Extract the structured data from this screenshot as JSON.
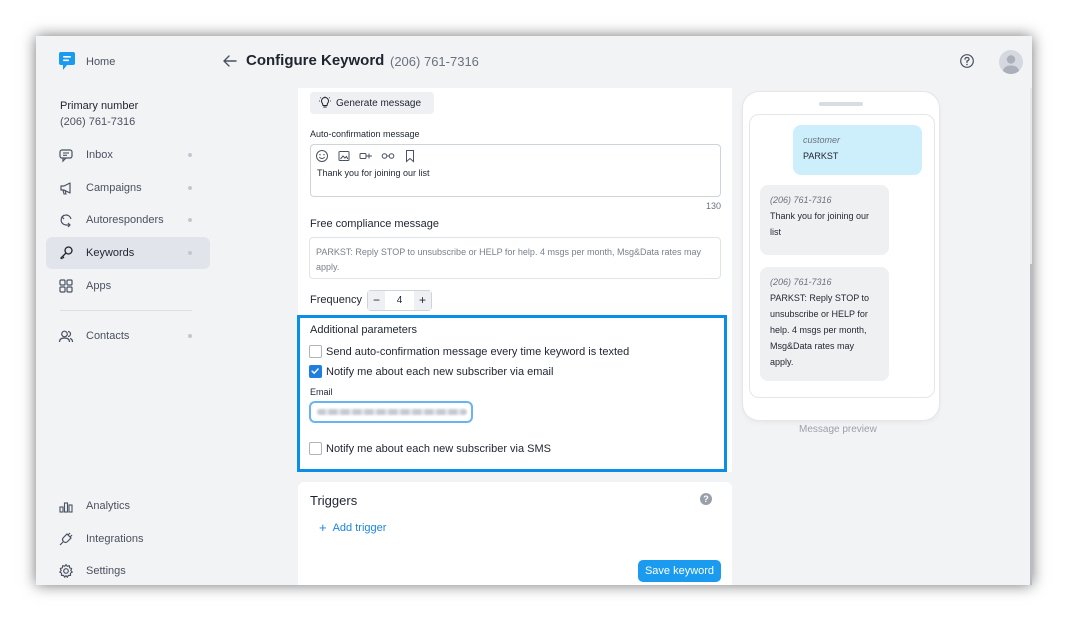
{
  "sidebar": {
    "home_label": "Home",
    "primary_label": "Primary number",
    "primary_number": "(206) 761-7316",
    "items": [
      {
        "label": "Inbox",
        "icon": "inbox-icon"
      },
      {
        "label": "Campaigns",
        "icon": "megaphone-icon"
      },
      {
        "label": "Autoresponders",
        "icon": "autoresponder-icon"
      },
      {
        "label": "Keywords",
        "icon": "key-icon"
      },
      {
        "label": "Apps",
        "icon": "apps-grid-icon"
      },
      {
        "label": "Contacts",
        "icon": "contacts-icon"
      },
      {
        "label": "Analytics",
        "icon": "bar-chart-icon"
      },
      {
        "label": "Integrations",
        "icon": "plug-icon"
      },
      {
        "label": "Settings",
        "icon": "gear-icon"
      }
    ]
  },
  "header": {
    "title": "Configure Keyword",
    "subtitle": "(206) 761-7316"
  },
  "form": {
    "generate_label": "Generate message",
    "auto_confirm_label": "Auto-confirmation message",
    "auto_confirm_value": "Thank you for joining our list",
    "char_count": "130",
    "compliance_label": "Free compliance message",
    "compliance_text": "PARKST: Reply STOP to unsubscribe or HELP for help. 4 msgs per month, Msg&Data rates may apply.",
    "frequency_label": "Frequency",
    "frequency_value": "4",
    "minus": "−",
    "plus": "+"
  },
  "params": {
    "title": "Additional parameters",
    "opt_send_every_time": "Send auto-confirmation message every time keyword is texted",
    "opt_send_every_time_checked": false,
    "opt_notify_email": "Notify me about each new subscriber via email",
    "opt_notify_email_checked": true,
    "email_label": "Email",
    "opt_notify_sms": "Notify me about each new subscriber via SMS",
    "opt_notify_sms_checked": false
  },
  "triggers": {
    "title": "Triggers",
    "help": "?",
    "add_label": "Add trigger",
    "save_label": "Save keyword"
  },
  "preview": {
    "customer_from": "customer",
    "customer_text": "PARKST",
    "reply1_from": "(206) 761-7316",
    "reply1_text": "Thank you for joining our list",
    "reply2_from": "(206) 761-7316",
    "reply2_text": "PARKST: Reply STOP to unsubscribe or HELP for help. 4 msgs per month, Msg&Data rates may apply.",
    "caption": "Message preview"
  },
  "colors": {
    "accent": "#1a9bf0",
    "highlight_border": "#0b8ee8",
    "outgoing_bubble": "#cdeffb"
  }
}
